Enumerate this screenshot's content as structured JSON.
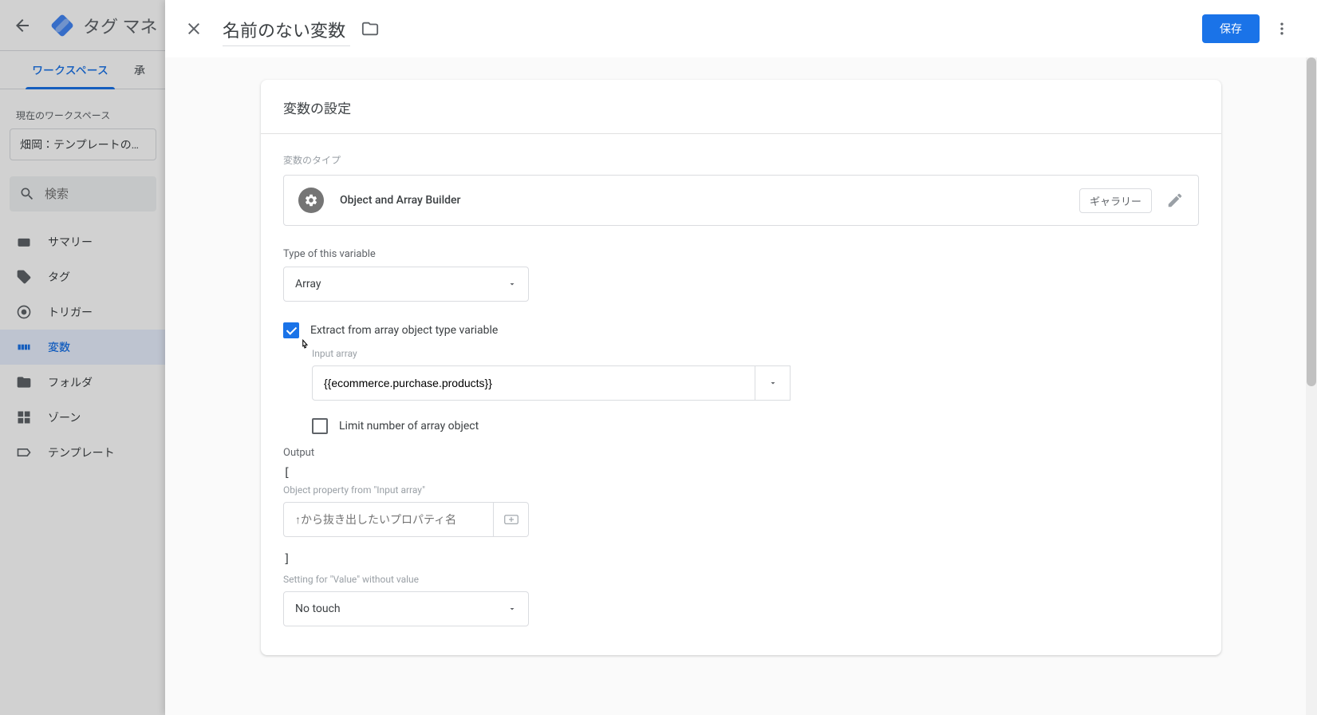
{
  "app": {
    "title": "タグ マネ"
  },
  "tabs": {
    "workspace": "ワークスペース",
    "preview": "承"
  },
  "workspace": {
    "currentLabel": "現在のワークスペース",
    "name": "畑岡：テンプレートの…"
  },
  "search": {
    "placeholder": "検索"
  },
  "sidebar": {
    "items": [
      {
        "label": "サマリー"
      },
      {
        "label": "タグ"
      },
      {
        "label": "トリガー"
      },
      {
        "label": "変数"
      },
      {
        "label": "フォルダ"
      },
      {
        "label": "ゾーン"
      },
      {
        "label": "テンプレート"
      }
    ]
  },
  "panel": {
    "title": "名前のない変数",
    "saveLabel": "保存",
    "cardTitle": "変数の設定",
    "varTypeSection": "変数のタイプ",
    "varTypeName": "Object and Array Builder",
    "galleryLabel": "ギャラリー",
    "fields": {
      "typeLabel": "Type of this variable",
      "typeValue": "Array",
      "extractLabel": "Extract from array object type variable",
      "inputArrayLabel": "Input array",
      "inputArrayValue": "{{ecommerce.purchase.products}}",
      "limitLabel": "Limit number of array object",
      "outputLabel": "Output",
      "openBracket": "[",
      "closeBracket": "]",
      "objPropLabel": "Object property from \"Input array\"",
      "objPropPlaceholder": "↑から抜き出したいプロパティ名",
      "settingValueLabel": "Setting for \"Value\" without value",
      "settingValue": "No touch"
    }
  }
}
